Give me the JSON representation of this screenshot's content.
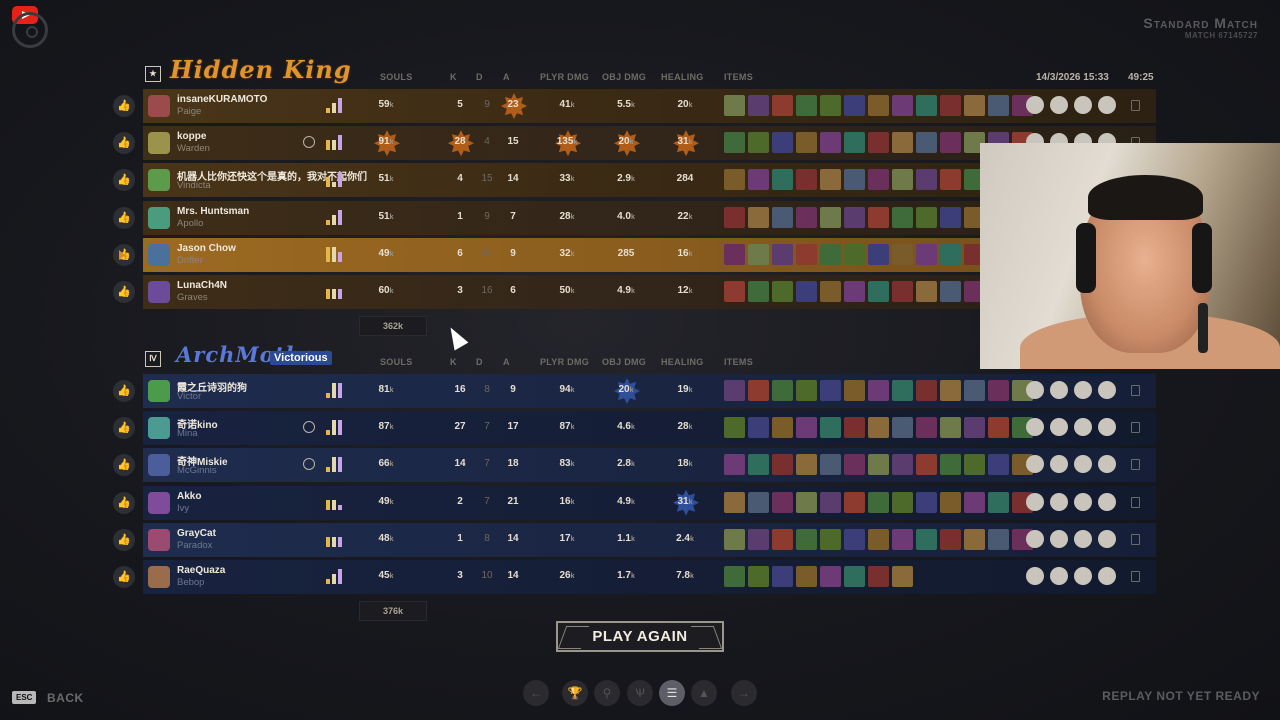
{
  "header": {
    "mode": "Standard Match",
    "match_id": "MATCH 67145727",
    "date": "14/3/2026 15:33",
    "duration": "49:25"
  },
  "columns": {
    "souls": "SOULS",
    "k": "K",
    "d": "D",
    "a": "A",
    "plyr_dmg": "PLYR DMG",
    "obj_dmg": "OBJ DMG",
    "healing": "HEALING",
    "items": "ITEMS"
  },
  "teams": [
    {
      "rank": "★",
      "name": "Hidden King",
      "souls_total": "362k",
      "players": [
        {
          "name": "insaneKURAMOTO",
          "hero": "Paige",
          "souls": "59",
          "k": "5",
          "d": "9",
          "a": "23",
          "pd": "41",
          "od": "5.5",
          "heal": "20",
          "hl": {
            "a": true
          },
          "bars": [
            1,
            2,
            3
          ],
          "items": 13
        },
        {
          "name": "koppe",
          "hero": "Warden",
          "souls": "91",
          "k": "28",
          "d": "4",
          "a": "15",
          "pd": "135",
          "od": "20",
          "heal": "31",
          "hl": {
            "souls": true,
            "k": true,
            "pd": true,
            "od": true,
            "heal": true
          },
          "rank": true,
          "bars": [
            2,
            2,
            3
          ],
          "items": 13
        },
        {
          "name": "机器人比你还快这个是真的，我对不起你们",
          "hero": "Vindicta",
          "souls": "51",
          "k": "4",
          "d": "15",
          "a": "14",
          "pd": "33",
          "od": "2.9",
          "heal": "284",
          "hl": {},
          "bars": [
            2,
            1,
            3
          ],
          "items": 13
        },
        {
          "name": "Mrs. Huntsman",
          "hero": "Apollo",
          "souls": "51",
          "k": "1",
          "d": "9",
          "a": "7",
          "pd": "28",
          "od": "4.0",
          "heal": "22",
          "hl": {},
          "bars": [
            1,
            2,
            3
          ],
          "items": 13
        },
        {
          "name": "Jason Chow",
          "hero": "Drifter",
          "souls": "49",
          "k": "6",
          "d": "10",
          "a": "9",
          "pd": "32",
          "od": "285",
          "heal": "16",
          "hl": {},
          "me": true,
          "bars": [
            3,
            3,
            2
          ],
          "items": 13
        },
        {
          "name": "LunaCh4N",
          "hero": "Graves",
          "souls": "60",
          "k": "3",
          "d": "16",
          "a": "6",
          "pd": "50",
          "od": "4.9",
          "heal": "12",
          "hl": {},
          "bars": [
            2,
            2,
            2
          ],
          "items": 13
        }
      ]
    },
    {
      "rank": "Ⅳ",
      "name": "ArchMother",
      "result": "Victorious",
      "souls_total": "376k",
      "players": [
        {
          "name": "霞之丘诗羽的狗",
          "hero": "Victor",
          "souls": "81",
          "k": "16",
          "d": "8",
          "a": "9",
          "pd": "94",
          "od": "20",
          "heal": "19",
          "hl": {
            "od": true
          },
          "bars": [
            1,
            3,
            3
          ],
          "items": 13
        },
        {
          "name": "奇诺kino",
          "hero": "Mina",
          "souls": "87",
          "k": "27",
          "d": "7",
          "a": "17",
          "pd": "87",
          "od": "4.6",
          "heal": "28",
          "hl": {},
          "rank": true,
          "bars": [
            1,
            3,
            3
          ],
          "items": 13
        },
        {
          "name": "奇神Miskie",
          "hero": "McGinnis",
          "souls": "66",
          "k": "14",
          "d": "7",
          "a": "18",
          "pd": "83",
          "od": "2.8",
          "heal": "18",
          "hl": {},
          "rank": true,
          "bars": [
            1,
            3,
            3
          ],
          "items": 13
        },
        {
          "name": "Akko",
          "hero": "Ivy",
          "souls": "49",
          "k": "2",
          "d": "7",
          "a": "21",
          "pd": "16",
          "od": "4.9",
          "heal": "31",
          "hl": {
            "heal": true
          },
          "bars": [
            2,
            2,
            1
          ],
          "items": 13
        },
        {
          "name": "GrayCat",
          "hero": "Paradox",
          "souls": "48",
          "k": "1",
          "d": "8",
          "a": "14",
          "pd": "17",
          "od": "1.1",
          "heal": "2.4",
          "hl": {},
          "bars": [
            2,
            2,
            2
          ],
          "items": 13
        },
        {
          "name": "RaeQuaza",
          "hero": "Bebop",
          "souls": "45",
          "k": "3",
          "d": "10",
          "a": "14",
          "pd": "26",
          "od": "1.7",
          "heal": "7.8",
          "hl": {},
          "bars": [
            1,
            2,
            3
          ],
          "items": 8
        }
      ]
    }
  ],
  "footer": {
    "play_again": "PLAY AGAIN",
    "esc": "ESC",
    "back": "BACK",
    "replay": "REPLAY NOT YET READY"
  },
  "nav": [
    "←",
    "🏆",
    "⚲",
    "Ѱ",
    "☰",
    "▲",
    "→"
  ],
  "colors": {
    "team1_accent": "#e0952c",
    "team2_accent": "#5a78d8",
    "highlight_me": "#9c6a22"
  }
}
